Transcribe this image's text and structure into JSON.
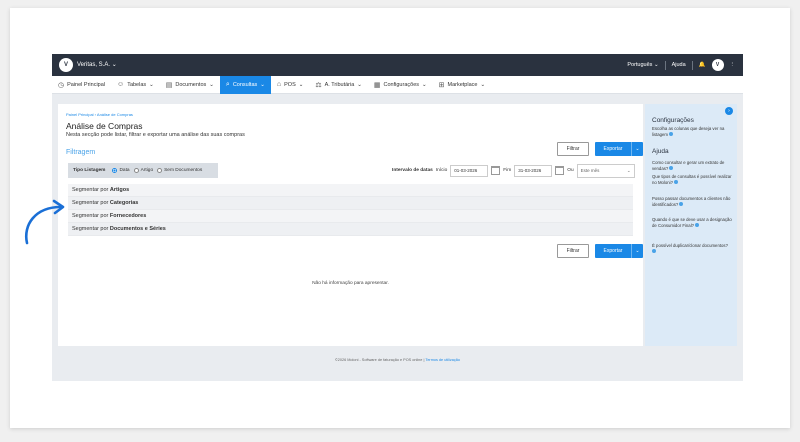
{
  "topbar": {
    "company": "Veritas, S.A.",
    "language": "Português",
    "help": "Ajuda",
    "caret": "⌄"
  },
  "menu": {
    "items": [
      {
        "label": "Painel Principal",
        "icon": "dashboard-icon",
        "glyph": "◷",
        "caret": ""
      },
      {
        "label": "Tabelas",
        "icon": "users-icon",
        "glyph": "☺",
        "caret": "⌄"
      },
      {
        "label": "Documentos",
        "icon": "document-icon",
        "glyph": "▤",
        "caret": "⌄"
      },
      {
        "label": "Consultas",
        "icon": "search-icon",
        "glyph": "⌕",
        "caret": "⌄"
      },
      {
        "label": "POS",
        "icon": "pos-icon",
        "glyph": "⌂",
        "caret": "⌄"
      },
      {
        "label": "A. Tributária",
        "icon": "scales-icon",
        "glyph": "⚖",
        "caret": "⌄"
      },
      {
        "label": "Configurações",
        "icon": "settings-icon",
        "glyph": "▦",
        "caret": "⌄"
      },
      {
        "label": "Marketplace",
        "icon": "marketplace-icon",
        "glyph": "⊞",
        "caret": "⌄"
      }
    ],
    "active_index": 3
  },
  "main": {
    "breadcrumb": "Painel Principal  ›  Análise de Compras",
    "title": "Análise de Compras",
    "subtitle": "Nesta secção pode listar, filtrar e exportar uma análise das suas compras",
    "filtragem": "Filtragem",
    "filter_label": "Filtrar",
    "export_label": "Exportar",
    "tipo_label": "Tipo Listagem",
    "tipo_options": [
      "Data",
      "Artigo",
      "Sem Documentos"
    ],
    "tipo_selected": 0,
    "intervalo_label": "Intervalo de datas",
    "inicio_label": "Início",
    "inicio_value": "01-03-2026",
    "fim_label": "Fim",
    "fim_value": "31-03-2026",
    "ou_label": "Ou",
    "period_value": "Este mês",
    "segments": [
      {
        "prefix": "Segmentar por ",
        "bold": "Artigos"
      },
      {
        "prefix": "Segmentar por ",
        "bold": "Categorias"
      },
      {
        "prefix": "Segmentar por ",
        "bold": "Fornecedores"
      },
      {
        "prefix": "Segmentar por ",
        "bold": "Documentos e Séries"
      }
    ],
    "empty_message": "Não há informação para apresentar."
  },
  "sidebar": {
    "config_title": "Configurações",
    "config_text": "Escolha as colunas que deseja ver na listagem",
    "help_title": "Ajuda",
    "help_links": [
      "Como consultar e gerar um extrato de vendas?",
      "Que tipos de consultas é possível realizar no Moloni?",
      "Posso passar documentos a clientes não identificados?",
      "Quando é que se deve usar a designação de Consumidor Final?",
      "É possível duplicar/clonar documentos?"
    ]
  },
  "footer": {
    "text": "©2026 Moloni - Software de faturação e POS online  |  ",
    "link": "Termos de utilização"
  },
  "colors": {
    "accent": "#1a88e6",
    "topbar": "#2a323f",
    "arrow": "#1a6fd6"
  }
}
